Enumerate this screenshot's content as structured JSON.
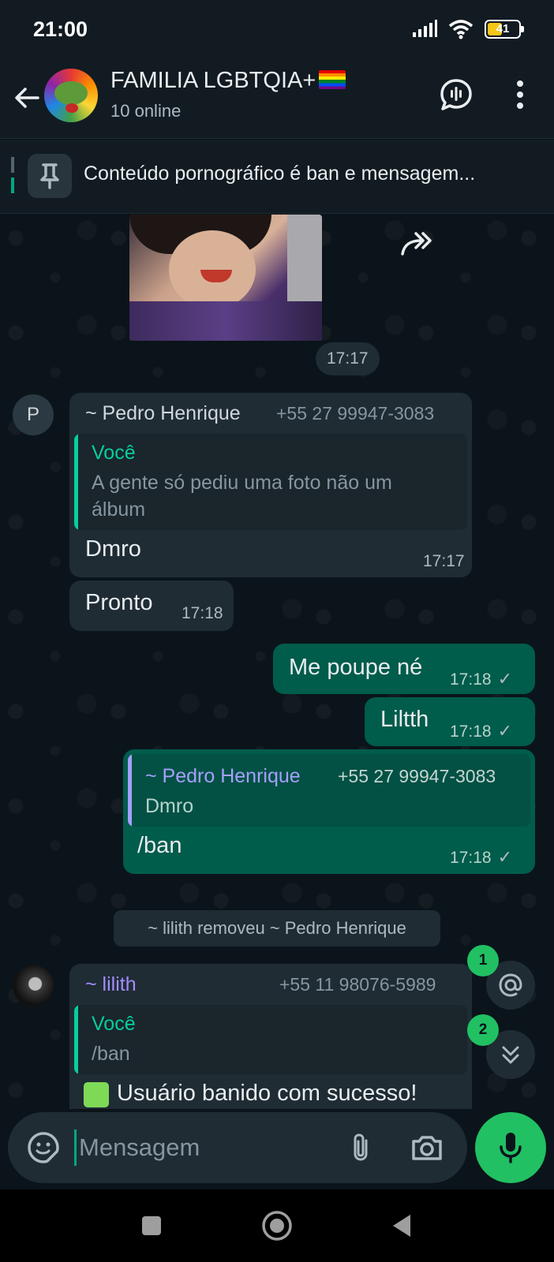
{
  "status_bar": {
    "time": "21:00",
    "battery": "41",
    "icons": [
      "signal-icon",
      "wifi-icon",
      "battery-icon"
    ]
  },
  "header": {
    "title": "FAMILIA LGBTQIA+",
    "subtitle": "10 online",
    "icons": [
      "back-arrow-icon",
      "group-call-icon",
      "more-vert-icon"
    ]
  },
  "pinned": {
    "text": "Conteúdo pornográfico é ban e mensagem..."
  },
  "messages": {
    "photo": {
      "time": "17:17"
    },
    "pedro_1": {
      "avatar_initial": "P",
      "sender": "~ Pedro Henrique",
      "phone": "+55 27 99947-3083",
      "quote_author": "Você",
      "quote_line1": "A gente só pediu uma foto não um",
      "quote_line2": "álbum",
      "text": "Dmro",
      "time": "17:17"
    },
    "pedro_2": {
      "text": "Pronto",
      "time": "17:18"
    },
    "out_1": {
      "text": "Me poupe né",
      "time": "17:18"
    },
    "out_2": {
      "text": "Liltth",
      "time": "17:18"
    },
    "out_3": {
      "quote_author": "~ Pedro Henrique",
      "quote_phone": "+55 27 99947-3083",
      "quote_text": "Dmro",
      "text": "/ban",
      "time": "17:18"
    },
    "system": "~ lilith removeu ~ Pedro Henrique",
    "lilith": {
      "sender": "~ lilith",
      "phone": "+55 11 98076-5989",
      "quote_author": "Você",
      "quote_text": "/ban",
      "text": "Usuário banido com sucesso!"
    }
  },
  "fabs": {
    "mentions_badge": "1",
    "scroll_badge": "2"
  },
  "composer": {
    "placeholder": "Mensagem"
  },
  "colors": {
    "background": "#0b141a",
    "header": "#121b22",
    "incoming_bubble": "#1f2c34",
    "outgoing_bubble": "#005c4b",
    "accent_green": "#21c063",
    "quote_you": "#06cf9c",
    "quote_other": "#a5a0ff",
    "lilith_name": "#a58bff"
  }
}
